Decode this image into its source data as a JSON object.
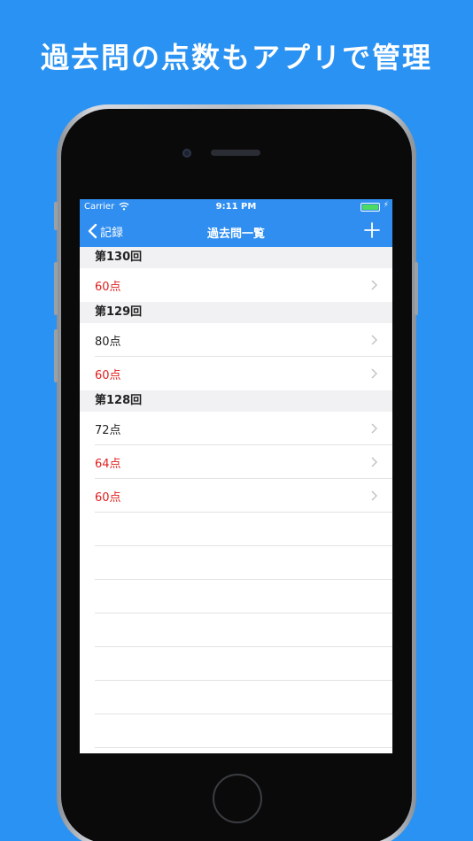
{
  "headline": "過去問の点数もアプリで管理",
  "status": {
    "carrier": "Carrier",
    "time": "9:11 PM"
  },
  "nav": {
    "back_label": "記録",
    "title": "過去問一覧"
  },
  "colors": {
    "background": "#2a92f2",
    "nav": "#2f8ef0",
    "fail": "#e0201e",
    "pass": "#222222"
  },
  "sections": [
    {
      "title": "第130回",
      "rows": [
        {
          "label": "60点",
          "color": "#e0201e"
        }
      ]
    },
    {
      "title": "第129回",
      "rows": [
        {
          "label": "80点",
          "color": "#222222"
        },
        {
          "label": "60点",
          "color": "#e0201e"
        }
      ]
    },
    {
      "title": "第128回",
      "rows": [
        {
          "label": "72点",
          "color": "#222222"
        },
        {
          "label": "64点",
          "color": "#e0201e"
        },
        {
          "label": "60点",
          "color": "#e0201e"
        }
      ]
    }
  ]
}
